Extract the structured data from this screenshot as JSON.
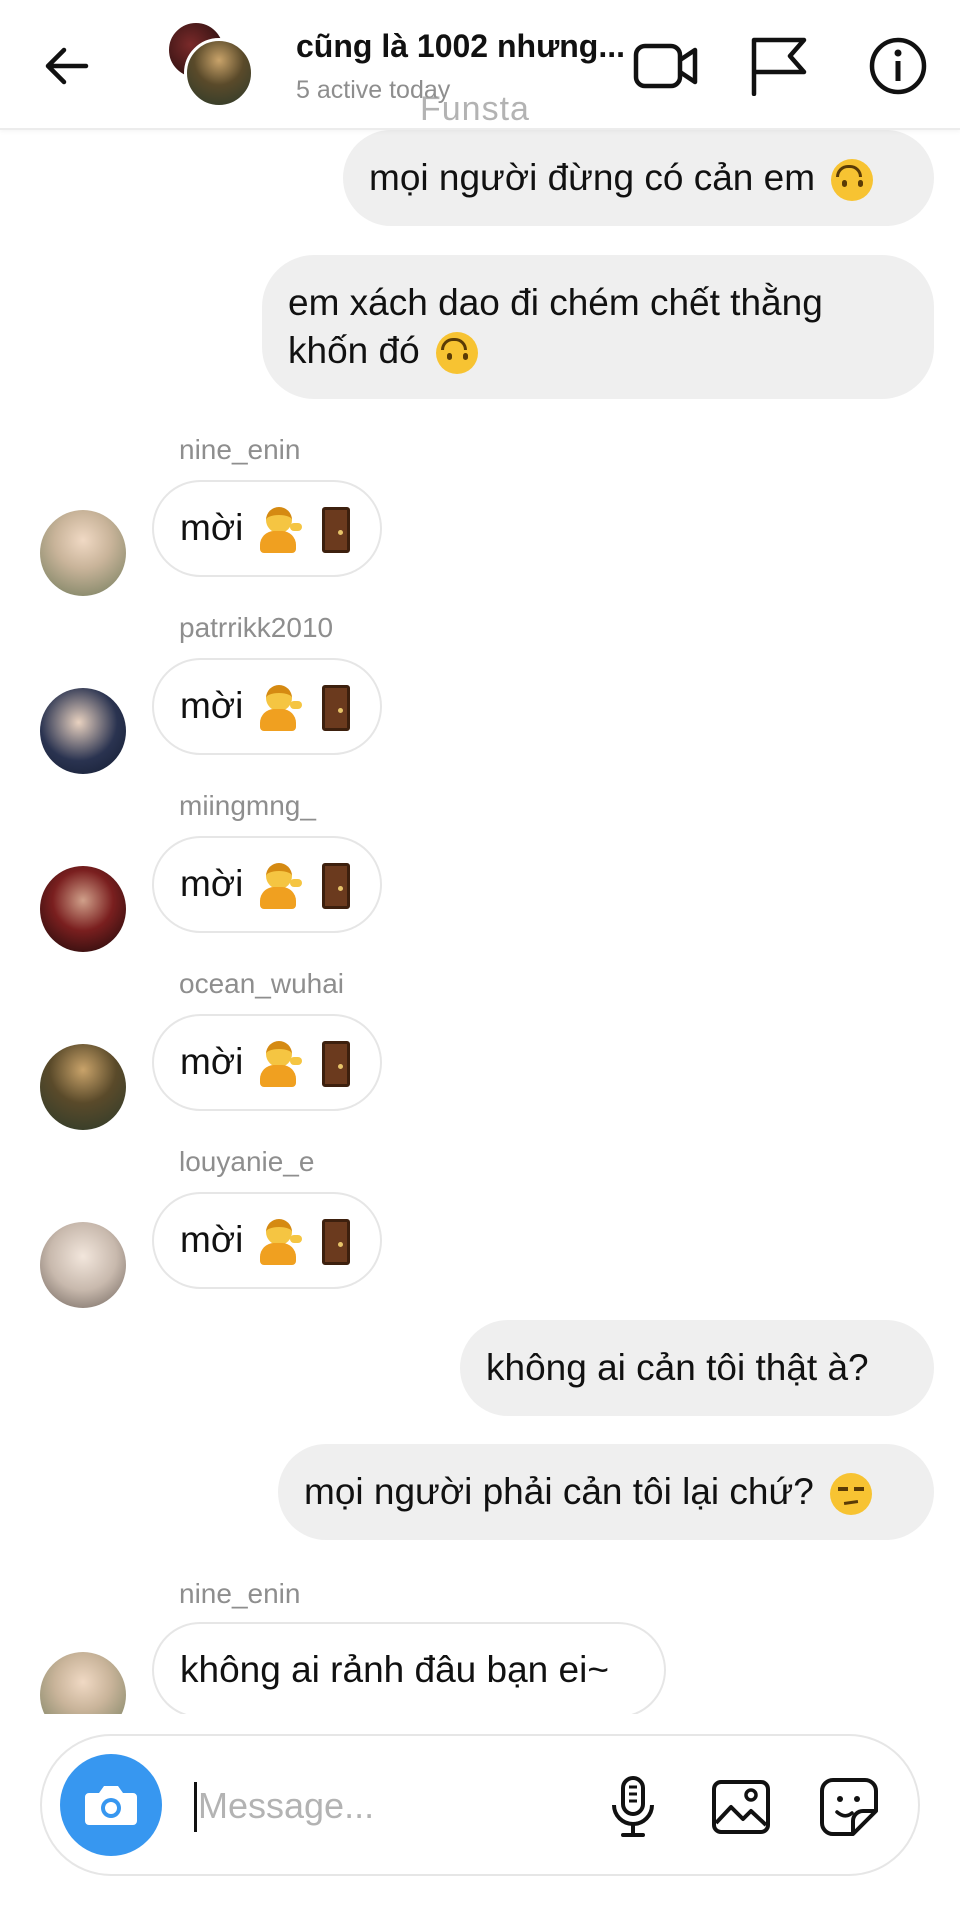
{
  "header": {
    "title": "cũng là 1002 nhưng...",
    "subtitle": "5 active today",
    "watermark": "Funsta",
    "icons": [
      "back-arrow-icon",
      "video-camera-icon",
      "flag-icon",
      "info-icon"
    ]
  },
  "messages": [
    {
      "type": "outgoing",
      "text": "mọi người đừng có cản em",
      "emoji": "upside-down-face"
    },
    {
      "type": "outgoing",
      "text": "em xách dao đi chém chết thằng khốn đó",
      "emoji": "upside-down-face"
    },
    {
      "type": "incoming",
      "username": "nine_enin",
      "text": "mời",
      "emoji": "person-tipping-hand door"
    },
    {
      "type": "incoming",
      "username": "patrrikk2010",
      "text": "mời",
      "emoji": "person-tipping-hand door"
    },
    {
      "type": "incoming",
      "username": "miingmng_",
      "text": "mời",
      "emoji": "person-tipping-hand door"
    },
    {
      "type": "incoming",
      "username": "ocean_wuhai",
      "text": "mời",
      "emoji": "person-tipping-hand door"
    },
    {
      "type": "incoming",
      "username": "louyanie_e",
      "text": "mời",
      "emoji": "person-tipping-hand door"
    },
    {
      "type": "outgoing",
      "text": "không ai cản tôi thật à?"
    },
    {
      "type": "outgoing",
      "text": "mọi người phải cản tôi lại chứ?",
      "emoji": "unamused-face"
    },
    {
      "type": "incoming",
      "username": "nine_enin",
      "text": "không ai rảnh đâu bạn ei~"
    }
  ],
  "composer": {
    "placeholder": "Message...",
    "value": "",
    "icons": [
      "camera-icon",
      "microphone-icon",
      "gallery-icon",
      "sticker-icon"
    ]
  },
  "colors": {
    "accent": "#3797f0",
    "outgoing_bubble": "#efefef",
    "incoming_border": "#e6e6e6",
    "secondary_text": "#8e8e8e"
  }
}
